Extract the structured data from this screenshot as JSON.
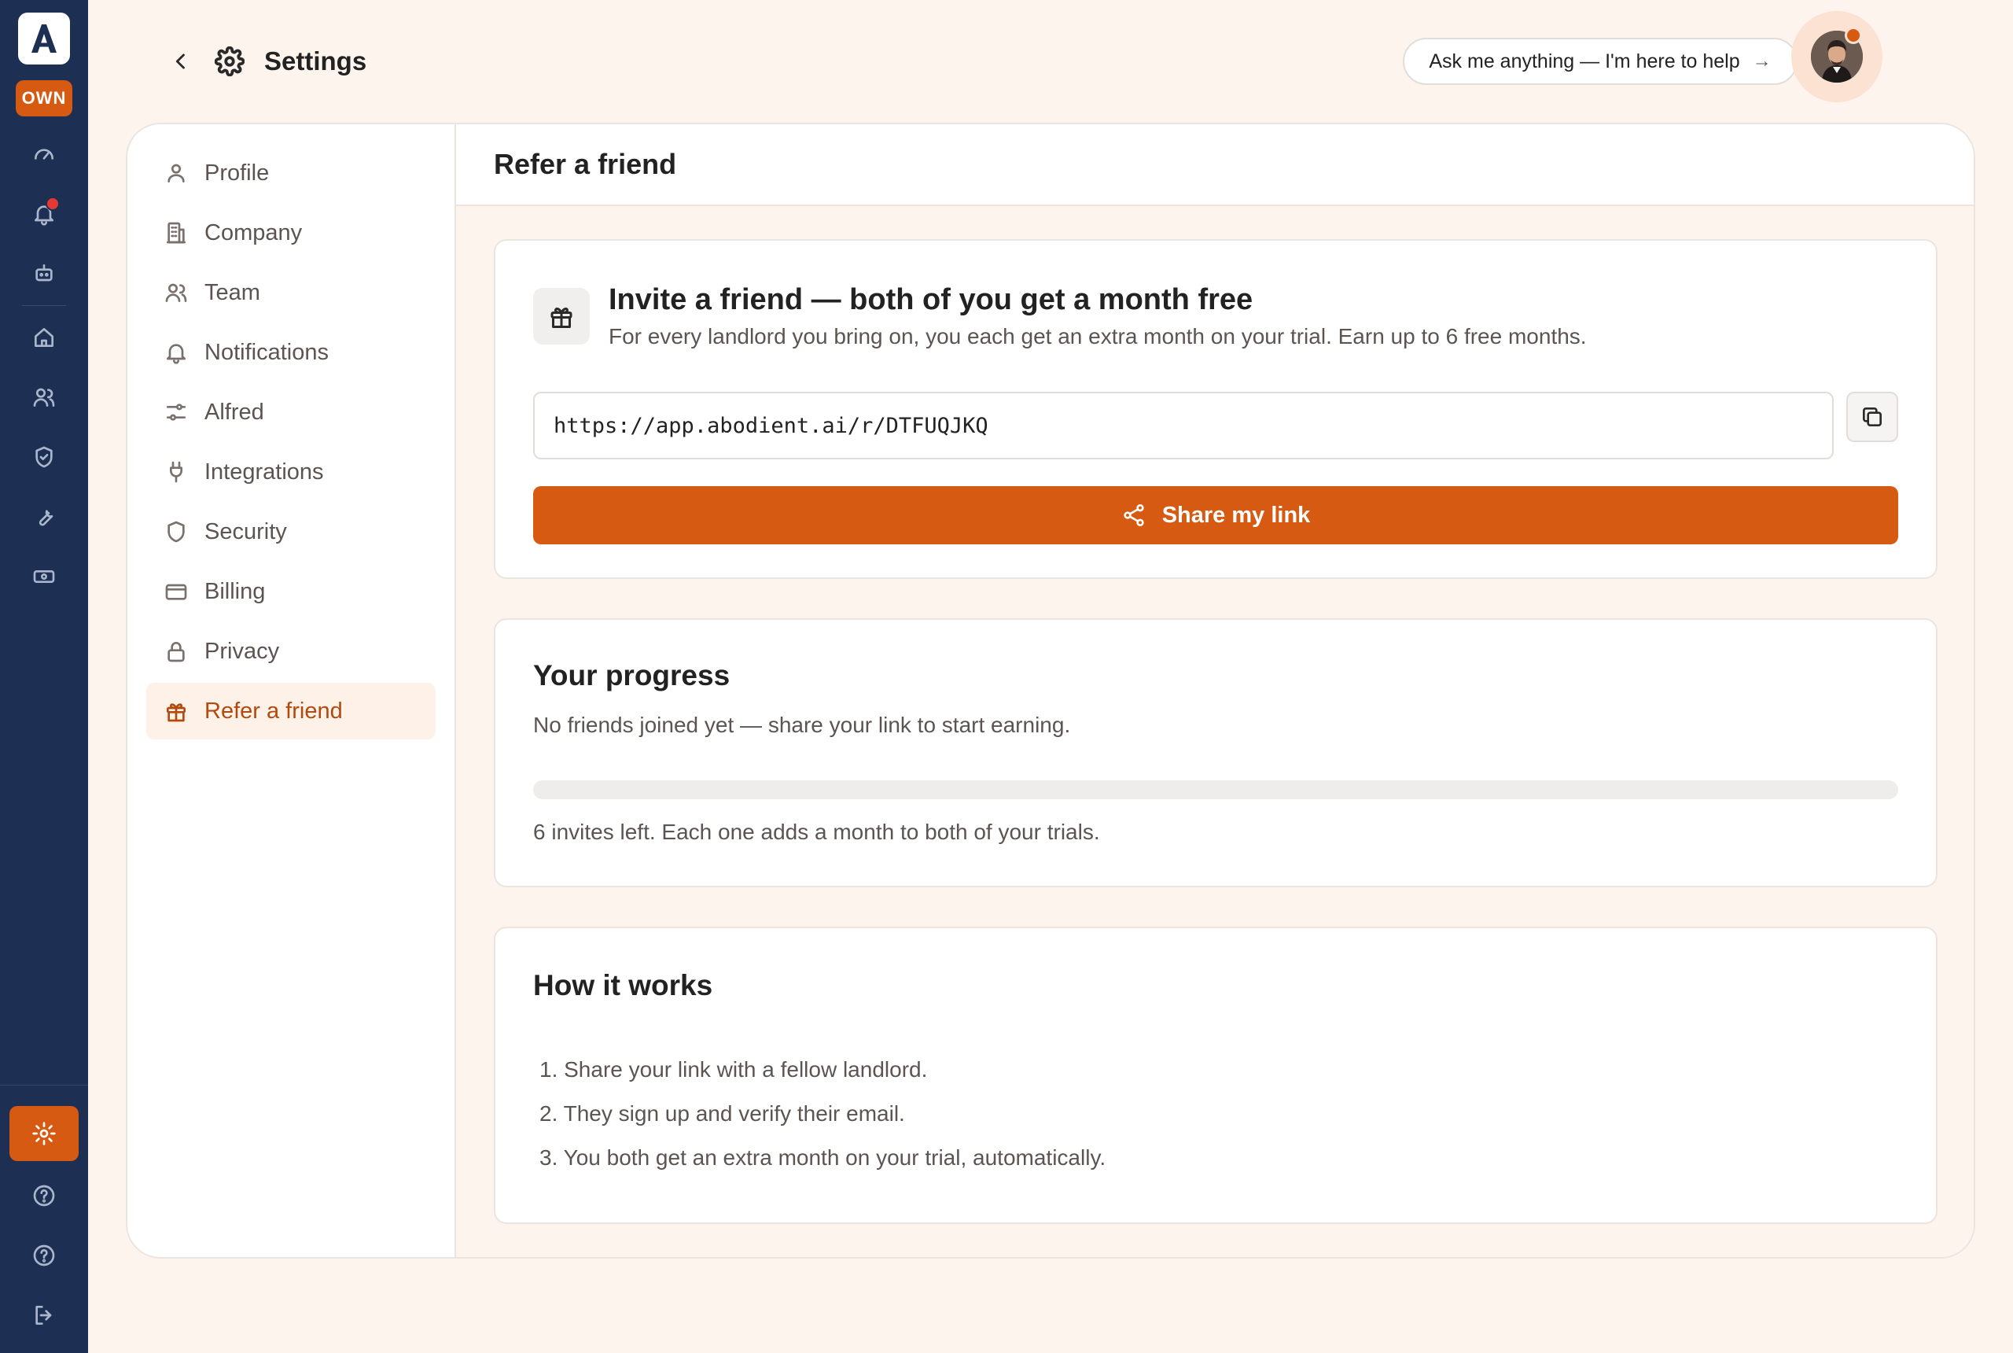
{
  "rail": {
    "logo_letter": "A",
    "badge": "OWN",
    "icons": [
      "gauge-icon",
      "bell-icon",
      "robot-icon",
      "home-icon",
      "users-icon",
      "shield-check-icon",
      "wrench-icon",
      "cash-icon"
    ],
    "bottom_icons": [
      "gear-icon",
      "help-icon",
      "help-icon",
      "logout-icon"
    ]
  },
  "header": {
    "title": "Settings",
    "ask_label": "Ask me anything — I'm here to help",
    "ask_arrow": "→"
  },
  "sidebar": {
    "items": [
      {
        "label": "Profile",
        "icon": "user-icon"
      },
      {
        "label": "Company",
        "icon": "building-icon"
      },
      {
        "label": "Team",
        "icon": "team-icon"
      },
      {
        "label": "Notifications",
        "icon": "bell-icon"
      },
      {
        "label": "Alfred",
        "icon": "sliders-icon"
      },
      {
        "label": "Integrations",
        "icon": "plug-icon"
      },
      {
        "label": "Security",
        "icon": "shield-icon"
      },
      {
        "label": "Billing",
        "icon": "card-icon"
      },
      {
        "label": "Privacy",
        "icon": "lock-icon"
      },
      {
        "label": "Refer a friend",
        "icon": "gift-icon",
        "active": true
      }
    ]
  },
  "main": {
    "title": "Refer a friend",
    "invite": {
      "title": "Invite a friend — both of you get a month free",
      "subtitle": "For every landlord you bring on, you each get an extra month on your trial. Earn up to 6 free months.",
      "link": "https://app.abodient.ai/r/DTFUQJKQ",
      "share_label": "Share my link"
    },
    "progress": {
      "title": "Your progress",
      "status": "No friends joined yet — share your link to start earning.",
      "fraction": 0,
      "note": "6 invites left. Each one adds a month to both of your trials."
    },
    "how": {
      "title": "How it works",
      "steps": [
        "1. Share your link with a fellow landlord.",
        "2. They sign up and verify their email.",
        "3. You both get an extra month on your trial, automatically."
      ]
    }
  },
  "colors": {
    "accent": "#d65a12",
    "rail": "#1d2f52",
    "background": "#fdf4ee"
  }
}
